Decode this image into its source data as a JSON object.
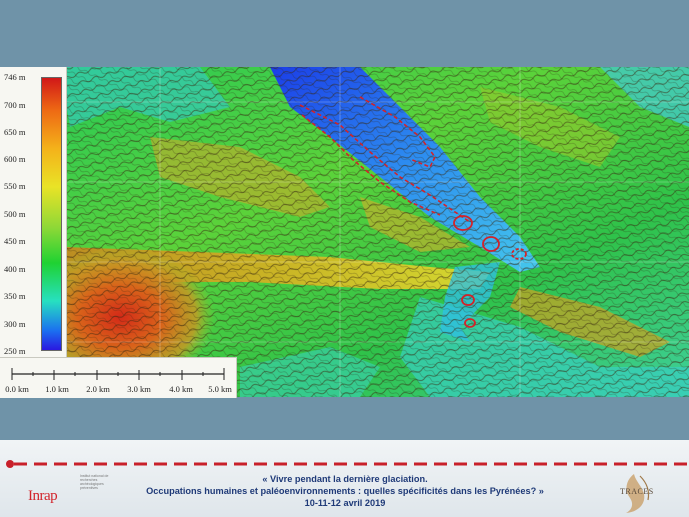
{
  "legend": {
    "elevations": [
      "746 m",
      "700 m",
      "650 m",
      "600 m",
      "550 m",
      "500 m",
      "450 m",
      "400 m",
      "350 m",
      "300 m",
      "250 m"
    ]
  },
  "scale_bar": {
    "labels": [
      "0.0 km",
      "1.0 km",
      "2.0 km",
      "3.0 km",
      "4.0 km",
      "5.0 km"
    ]
  },
  "footer": {
    "line1": "« Vivre pendant la dernière glaciation.",
    "line2": "Occupations humaines et paléoenvironnements : quelles spécificités dans les Pyrénées? »",
    "line3": "10-11-12 avril 2019",
    "inrap_logo": "Inrap",
    "inrap_small": "Institut national de recherches archéologiques préventives",
    "traces_logo": "TRACES"
  },
  "colors": {
    "background": "#6f93a8",
    "footer_text": "#1f3a78",
    "accent_red": "#c8202a"
  }
}
